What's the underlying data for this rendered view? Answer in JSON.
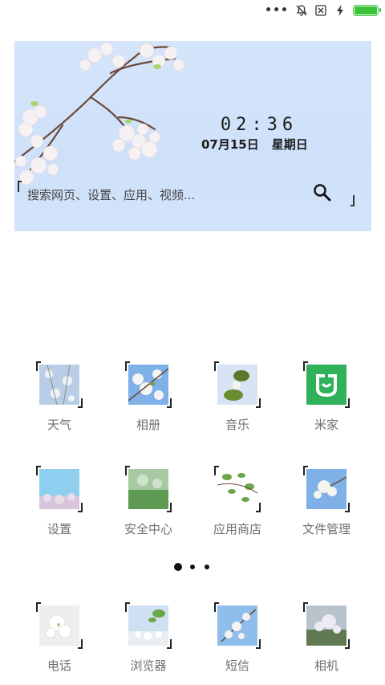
{
  "status_bar": {
    "dots": "•••",
    "icons": [
      "mute-bell-icon",
      "no-sim-icon",
      "charging-icon",
      "battery-icon"
    ],
    "battery_level": 1.0,
    "battery_color": "#3cc33c"
  },
  "widget": {
    "time": "02:36",
    "date": "07月15日",
    "weekday": "星期日",
    "search_placeholder": "搜索网页、设置、应用、视频...",
    "background": "#d4e5fb"
  },
  "apps_row1": [
    {
      "label": "天气"
    },
    {
      "label": "相册"
    },
    {
      "label": "音乐"
    },
    {
      "label": "米家"
    }
  ],
  "apps_row2": [
    {
      "label": "设置"
    },
    {
      "label": "安全中心"
    },
    {
      "label": "应用商店"
    },
    {
      "label": "文件管理"
    }
  ],
  "dock": [
    {
      "label": "电话"
    },
    {
      "label": "浏览器"
    },
    {
      "label": "短信"
    },
    {
      "label": "相机"
    }
  ],
  "pager": {
    "pages": 3,
    "current": 1
  }
}
